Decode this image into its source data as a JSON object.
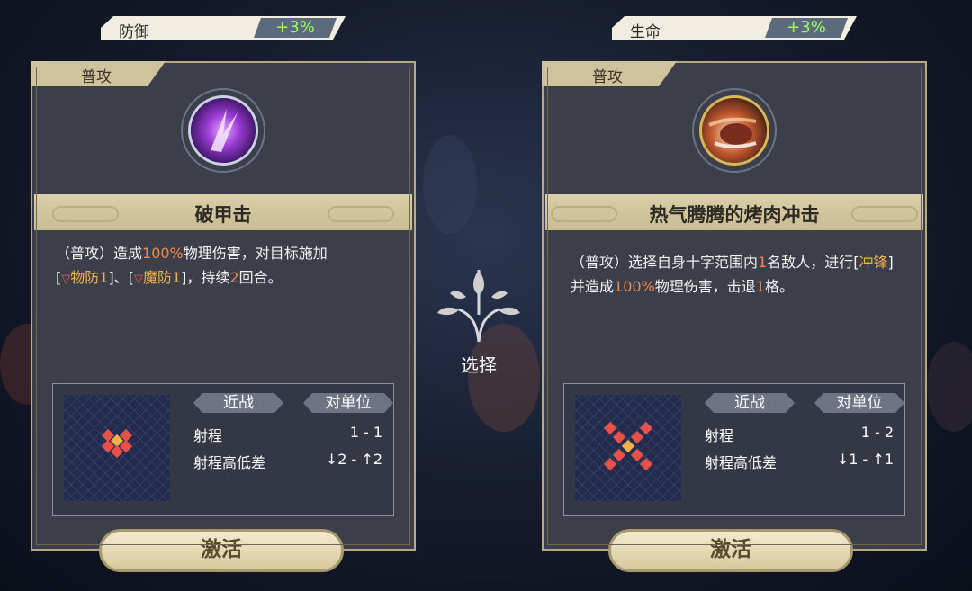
{
  "top_stats": [
    {
      "label": "防御",
      "value": "+3%"
    },
    {
      "label": "生命",
      "value": "+3%"
    }
  ],
  "cards": [
    {
      "tab": "普攻",
      "skill_name": "破甲击",
      "icon": "purple-slash-icon",
      "desc_prefix": "（普攻）造成",
      "desc_pct": "100%",
      "desc_mid": "物理伤害，对目标施加",
      "debuff1": "物防1",
      "debuff2": "魔防1",
      "desc_sep": "]、[",
      "desc_tail1": "]，持续",
      "duration": "2",
      "desc_tail2": "回合。",
      "range_type": "近战",
      "target_type": "对单位",
      "range_label": "射程",
      "range_value": "1 - 1",
      "height_label": "射程高低差",
      "height_value": "↓2 - ↑2",
      "button": "激活"
    },
    {
      "tab": "普攻",
      "skill_name": "热气腾腾的烤肉冲击",
      "icon": "roast-meat-charge-icon",
      "desc_prefix": "（普攻）选择自身十字范围内",
      "count": "1",
      "desc_mid": "名敌人，进行[",
      "tag": "冲锋",
      "desc_mid2": "]并造成",
      "desc_pct": "100%",
      "desc_tail1": "物理伤害，击退",
      "knock": "1",
      "desc_tail2": "格。",
      "range_type": "近战",
      "target_type": "对单位",
      "range_label": "射程",
      "range_value": "1 - 2",
      "height_label": "射程高低差",
      "height_value": "↓1 - ↑1",
      "button": "激活"
    }
  ],
  "center": {
    "label": "选择",
    "icon": "tree-emblem-icon"
  },
  "colors": {
    "highlight": "#f08a4b",
    "tag": "#f2b24a",
    "stat_value": "#9cff5a"
  }
}
